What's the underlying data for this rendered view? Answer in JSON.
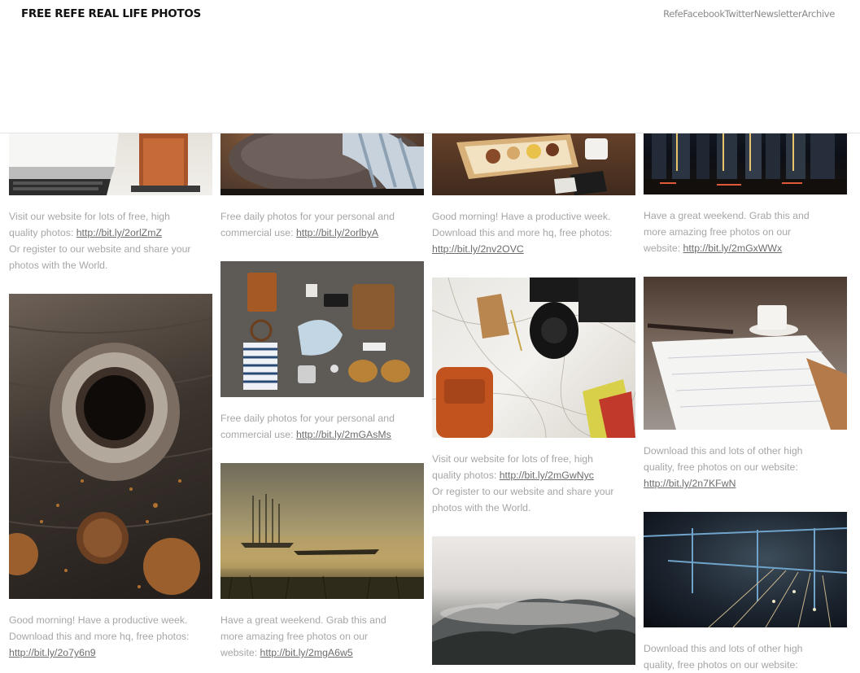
{
  "site": {
    "title": "FREE REFE REAL LIFE PHOTOS"
  },
  "nav": [
    "Refe",
    "Facebook",
    "Twitter",
    "Newsletter",
    "Archive"
  ],
  "captions": {
    "laptop": {
      "lines": [
        "Visit our website for lots of free, high",
        "quality photos: "
      ],
      "link": "http://bit.ly/2orlZmZ",
      "after": [
        "Or register to our website and share your",
        "photos with the World."
      ]
    },
    "person": {
      "lines": [
        "Free daily photos for your personal and",
        "commercial use: "
      ],
      "link": "http://bit.ly/2orlbyA"
    },
    "food": {
      "lines": [
        "Good morning! Have a productive week.",
        "Download this and more hq, free photos:"
      ],
      "link": "http://bit.ly/2nv2OVC"
    },
    "city": {
      "lines": [
        "Have a great weekend. Grab this and",
        "more amazing free photos on our",
        "website: "
      ],
      "link": "http://bit.ly/2mGxWWx"
    },
    "flatlay": {
      "lines": [
        "Free daily photos for your personal and",
        "commercial use: "
      ],
      "link": "http://bit.ly/2mGAsMs"
    },
    "map": {
      "lines": [
        "Visit our website for lots of free, high",
        "quality photos: "
      ],
      "link": "http://bit.ly/2mGwNyc",
      "after": [
        "Or register to our website and share your",
        "photos with the World."
      ]
    },
    "notebook": {
      "lines": [
        "Download this and lots of other high",
        "quality, free photos on our website:"
      ],
      "link": "http://bit.ly/2n7KFwN"
    },
    "coffee": {
      "lines": [
        "Good morning! Have a productive week.",
        "Download this and more hq, free photos:"
      ],
      "link": "http://bit.ly/2o7y6n9"
    },
    "lake": {
      "lines": [
        "Have a great weekend. Grab this and",
        "more amazing free photos on our",
        "website: "
      ],
      "link": "http://bit.ly/2mgA6w5"
    },
    "rail": {
      "lines": [
        "Download this and lots of other high",
        "quality, free photos on our website:"
      ]
    }
  }
}
